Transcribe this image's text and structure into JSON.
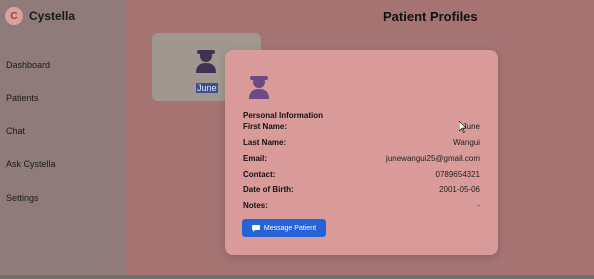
{
  "app": {
    "name": "Cystella",
    "logo_letter": "C"
  },
  "sidebar": {
    "items": [
      {
        "label": "Dashboard"
      },
      {
        "label": "Patients"
      },
      {
        "label": "Chat"
      },
      {
        "label": "Ask Cystella"
      },
      {
        "label": "Settings"
      }
    ]
  },
  "page": {
    "title": "Patient Profiles"
  },
  "patient_card": {
    "name": "June"
  },
  "modal": {
    "section_title": "Personal Information",
    "fields": [
      {
        "label": "First Name:",
        "value": "June"
      },
      {
        "label": "Last Name:",
        "value": "Wangui"
      },
      {
        "label": "Email:",
        "value": "junewangui25@gmail.com"
      },
      {
        "label": "Contact:",
        "value": "0789654321"
      },
      {
        "label": "Date of Birth:",
        "value": "2001-05-06"
      },
      {
        "label": "Notes:",
        "value": "-"
      }
    ],
    "button_label": "Message Patient"
  },
  "icons": {
    "avatar": "user-icon",
    "chat": "chat-bubble-icon",
    "cursor": "mouse-cursor-icon"
  },
  "colors": {
    "accent": "#2563d9",
    "avatar": "#6b4a86"
  }
}
